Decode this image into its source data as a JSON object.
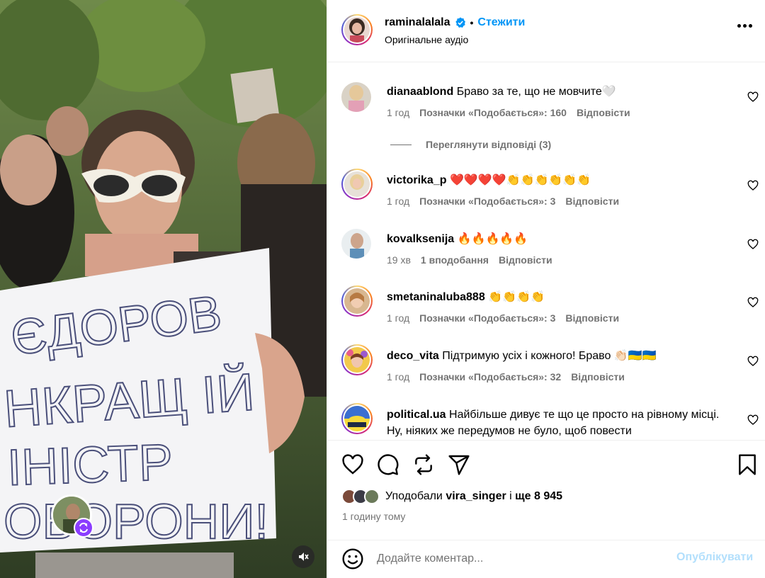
{
  "post": {
    "author": "raminalalala",
    "follow_label": "Стежити",
    "separator": "•",
    "audio_label": "Оригінальне аудіо",
    "more_icon": "more-horizontal-icon"
  },
  "media": {
    "sign_lines": [
      "ЄДОРОВ",
      "НКРАЩ ІЙ",
      "ІНІСТР",
      "ОБОРОНИ!"
    ],
    "mute_icon": "speaker-muted-icon",
    "collab_icon": "collab-arrows-icon"
  },
  "comments": [
    {
      "user": "dianaablond",
      "text": "Браво за те, що не мовчите🤍",
      "time": "1 год",
      "likes": "Позначки «Подобається»: 160",
      "reply": "Відповісти",
      "view_replies": "Переглянути відповіді (3)"
    },
    {
      "user": "victorika_p",
      "text": "❤️❤️❤️❤️👏👏👏👏👏👏",
      "time": "1 год",
      "likes": "Позначки «Подобається»: 3",
      "reply": "Відповісти"
    },
    {
      "user": "kovalksenija",
      "text": "🔥🔥🔥🔥🔥",
      "time": "19 хв",
      "likes": "1 вподобання",
      "reply": "Відповісти"
    },
    {
      "user": "smetaninaluba888",
      "text": "👏👏👏👏",
      "time": "1 год",
      "likes": "Позначки «Подобається»: 3",
      "reply": "Відповісти"
    },
    {
      "user": "deco_vita",
      "text": "Підтримую усіх і кожного! Браво 👏🏻🇺🇦🇺🇦",
      "time": "1 год",
      "likes": "Позначки «Подобається»: 32",
      "reply": "Відповісти"
    },
    {
      "user": "political.ua",
      "text": "Найбільше дивує те що це просто на рівному місці. Ну, ніяких же передумов не було, щоб повести"
    }
  ],
  "actions": {
    "liked_by_prefix": "Уподобали",
    "liked_by_user": "vira_singer",
    "liked_by_conj": "і",
    "liked_by_rest": "ще 8 945",
    "time_ago": "1 годину тому"
  },
  "composer": {
    "placeholder": "Додайте коментар...",
    "post_label": "Опублікувати"
  },
  "colors": {
    "accent": "#0095f6",
    "muted": "#737373",
    "post_disabled": "#b2dffc",
    "collab_badge": "#8b3dff"
  }
}
